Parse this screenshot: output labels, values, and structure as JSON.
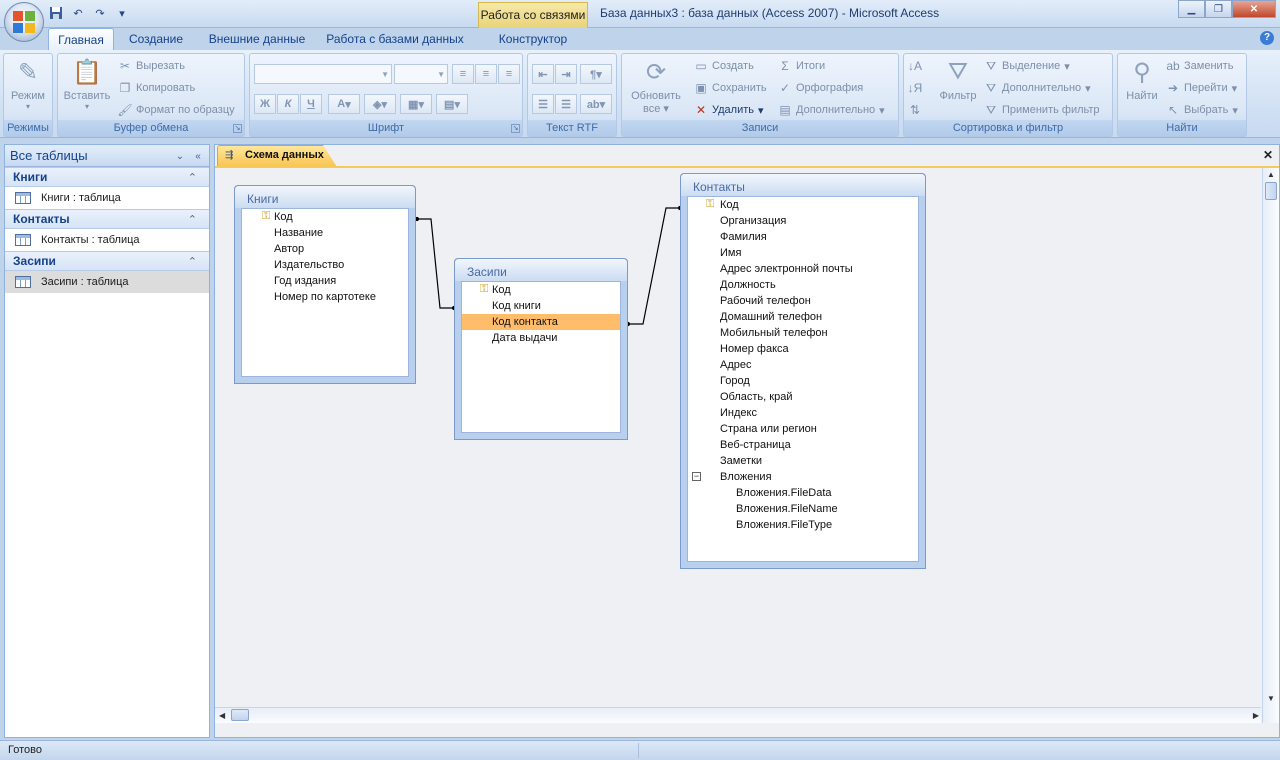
{
  "title_bar": {
    "context_tab_title": "Работа со связями",
    "app_title": "База данных3 : база данных (Access 2007)  -  Microsoft Access",
    "qat_icons": [
      "save-icon",
      "undo-icon",
      "redo-icon",
      "customize-qat-icon"
    ]
  },
  "tabs": [
    "Главная",
    "Создание",
    "Внешние данные",
    "Работа с базами данных",
    "Конструктор"
  ],
  "active_tab": "Главная",
  "ribbon": {
    "views": {
      "label": "Режимы",
      "view_button": "Режим"
    },
    "clipboard": {
      "label": "Буфер обмена",
      "paste": "Вставить",
      "cut": "Вырезать",
      "copy": "Копировать",
      "format_painter": "Формат по образцу"
    },
    "font": {
      "label": "Шрифт",
      "bold": "Ж",
      "italic": "К",
      "underline": "Ч",
      "font_color": "A"
    },
    "rtf": {
      "label": "Текст RTF"
    },
    "records": {
      "label": "Записи",
      "refresh": "Обновить",
      "refresh2": "все",
      "new": "Создать",
      "save": "Сохранить",
      "delete": "Удалить",
      "totals": "Итоги",
      "spelling": "Орфография",
      "more": "Дополнительно"
    },
    "sort_filter": {
      "label": "Сортировка и фильтр",
      "filter": "Фильтр",
      "selection": "Выделение",
      "advanced": "Дополнительно",
      "toggle_filter": "Применить фильтр"
    },
    "find": {
      "label": "Найти",
      "find": "Найти",
      "replace": "Заменить",
      "goto": "Перейти",
      "select": "Выбрать"
    }
  },
  "nav_pane": {
    "header": "Все таблицы",
    "groups": [
      {
        "name": "Книги",
        "item": "Книги : таблица"
      },
      {
        "name": "Контакты",
        "item": "Контакты : таблица"
      },
      {
        "name": "Засипи",
        "item": "Засипи : таблица"
      }
    ]
  },
  "document": {
    "tab_label": "Схема данных",
    "tables": {
      "knigi": {
        "title": "Книги",
        "fields": [
          "Код",
          "Название",
          "Автор",
          "Издательство",
          "Год издания",
          "Номер по картотеке"
        ]
      },
      "zasipi": {
        "title": "Засипи",
        "fields": [
          "Код",
          "Код книги",
          "Код контакта",
          "Дата выдачи"
        ]
      },
      "kontakty": {
        "title": "Контакты",
        "fields": [
          "Код",
          "Организация",
          "Фамилия",
          "Имя",
          "Адрес электронной почты",
          "Должность",
          "Рабочий телефон",
          "Домашний телефон",
          "Мобильный телефон",
          "Номер факса",
          "Адрес",
          "Город",
          "Область, край",
          "Индекс",
          "Страна или регион",
          "Веб-страница",
          "Заметки",
          "Вложения"
        ],
        "subfields": [
          "Вложения.FileData",
          "Вложения.FileName",
          "Вложения.FileType"
        ]
      }
    },
    "selected_field": "Код контакта"
  },
  "status": {
    "text": "Готово"
  },
  "colors": {
    "accent": "#15428b",
    "highlight": "#ffbc6a",
    "doctab": "#f9c552"
  }
}
